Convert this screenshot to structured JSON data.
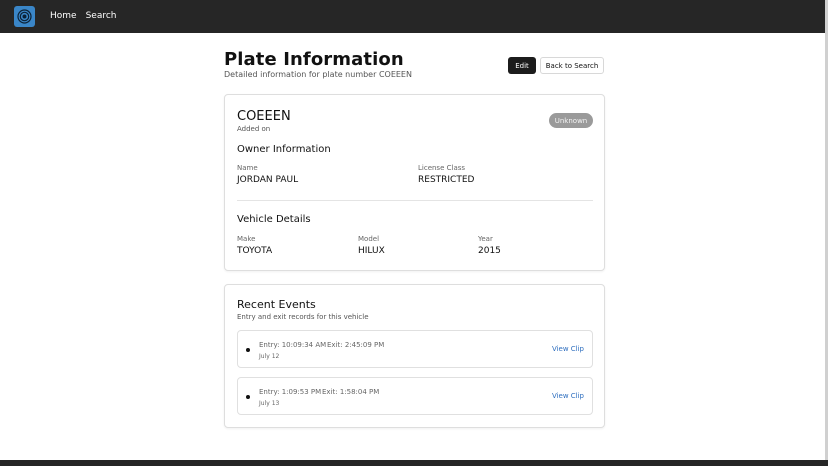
{
  "nav": {
    "home": "Home",
    "search": "Search"
  },
  "header": {
    "title": "Plate Information",
    "subtitle": "Detailed information for plate number COEEEN",
    "edit_label": "Edit",
    "back_label": "Back to Search"
  },
  "plate": {
    "number": "COEEEN",
    "added_on": "Added on",
    "status": "Unknown"
  },
  "owner": {
    "heading": "Owner Information",
    "name_label": "Name",
    "name_value": "JORDAN PAUL",
    "license_label": "License Class",
    "license_value": "RESTRICTED"
  },
  "vehicle": {
    "heading": "Vehicle Details",
    "make_label": "Make",
    "make_value": "TOYOTA",
    "model_label": "Model",
    "model_value": "HILUX",
    "year_label": "Year",
    "year_value": "2015"
  },
  "events": {
    "title": "Recent Events",
    "subtitle": "Entry and exit records for this vehicle",
    "items": [
      {
        "entry": "Entry: 10:09:34 AM",
        "exit": "Exit: 2:45:09 PM",
        "date": "July 12",
        "link": "View Clip"
      },
      {
        "entry": "Entry: 1:09:53 PM",
        "exit": "Exit: 1:58:04 PM",
        "date": "July 13",
        "link": "View Clip"
      }
    ]
  },
  "colors": {
    "topbar": "#262626",
    "logo": "#3a86c8",
    "edit_button": "#1c1c1c",
    "badge": "#9a9a9a",
    "link": "#2f6fbf"
  },
  "icons": {
    "logo": "camera-lens-icon",
    "event_marker": "bullet-dot-icon"
  }
}
